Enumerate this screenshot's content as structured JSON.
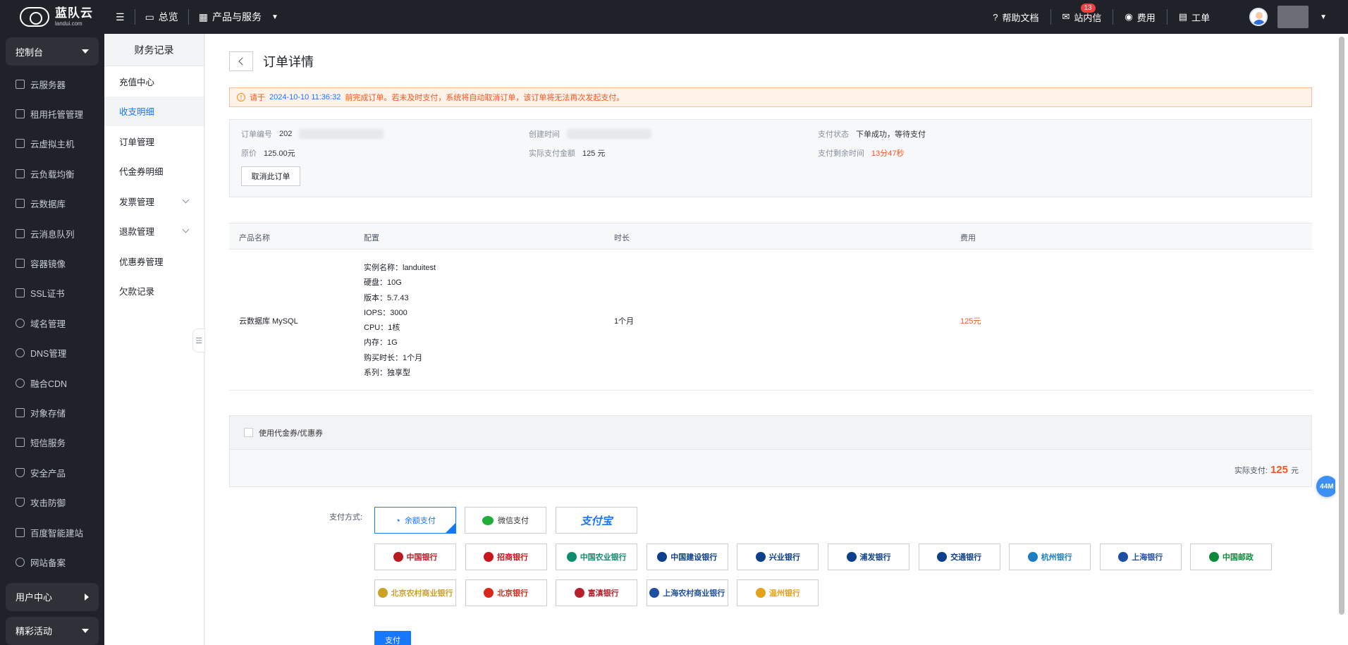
{
  "brand": {
    "name": "蓝队云",
    "domain": "landui.com"
  },
  "topnav": {
    "overview": "总览",
    "products": "产品与服务"
  },
  "topright": {
    "help": "帮助文档",
    "messages": "站内信",
    "message_count": "13",
    "billing": "费用",
    "tickets": "工单"
  },
  "sidebar": {
    "console": "控制台",
    "items": [
      "云服务器",
      "租用托管管理",
      "云虚拟主机",
      "云负载均衡",
      "云数据库",
      "云消息队列",
      "容器镜像",
      "SSL证书",
      "域名管理",
      "DNS管理",
      "融合CDN",
      "对象存储",
      "短信服务",
      "安全产品",
      "攻击防御",
      "百度智能建站",
      "网站备案"
    ],
    "user_center": "用户中心",
    "activities": "精彩活动"
  },
  "subnav": {
    "title": "财务记录",
    "items": [
      "充值中心",
      "收支明细",
      "订单管理",
      "代金券明细",
      "发票管理",
      "退款管理",
      "优惠券管理",
      "欠款记录"
    ]
  },
  "page": {
    "title": "订单详情"
  },
  "notice": {
    "prefix": "请于",
    "deadline": "2024-10-10 11:36:32",
    "suffix": "前完成订单。若未及时支付，系统将自动取消订单，该订单将无法再次发起支付。"
  },
  "order": {
    "no_label": "订单编号",
    "no_value": "202",
    "created_label": "创建时间",
    "status_label": "支付状态",
    "status_value": "下单成功，等待支付",
    "orig_label": "原价",
    "orig_value": "125.00元",
    "actual_label": "实际支付金额",
    "actual_value": "125 元",
    "remain_label": "支付剩余时间",
    "remain_value": "13分47秒",
    "cancel": "取消此订单"
  },
  "table": {
    "headers": [
      "产品名称",
      "配置",
      "时长",
      "费用"
    ],
    "row": {
      "product": "云数据库 MySQL",
      "config": [
        "实例名称：landuitest",
        "硬盘：10G",
        "版本：5.7.43",
        "IOPS：3000",
        "CPU：1核",
        "内存：1G",
        "购买时长：1个月",
        "系列：独享型"
      ],
      "duration": "1个月",
      "fee": "125元"
    }
  },
  "coupon": {
    "label": "使用代金券/优惠券",
    "actual_label": "实际支付:",
    "actual_value": "125",
    "unit": "元"
  },
  "payment": {
    "label": "支付方式:",
    "methods": [
      "余额支付",
      "微信支付",
      "支付宝"
    ],
    "banks": [
      "中国银行",
      "招商银行",
      "中国农业银行",
      "中国建设银行",
      "兴业银行",
      "浦发银行",
      "交通银行",
      "杭州银行",
      "上海银行",
      "中国邮政",
      "北京农村商业银行",
      "北京银行",
      "富滇银行",
      "上海农村商业银行",
      "温州银行"
    ],
    "bank_colors": [
      "#b81c22",
      "#c8161e",
      "#0f8c6e",
      "#0c3f8c",
      "#0c3f8c",
      "#0c3f8c",
      "#0c3f8c",
      "#1a7fc1",
      "#1e4fa0",
      "#0a8a3a",
      "#c9a227",
      "#d7281b",
      "#b6202a",
      "#1e4fa0",
      "#e3a21a"
    ],
    "pay_button": "支付"
  },
  "float_badge": "44M"
}
